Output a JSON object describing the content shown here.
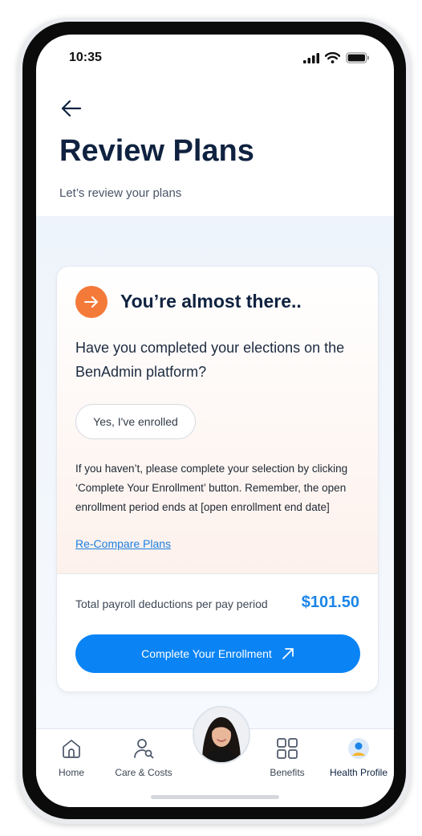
{
  "status_bar": {
    "time": "10:35"
  },
  "header": {
    "title": "Review Plans",
    "subtitle": "Let’s review your plans"
  },
  "card": {
    "heading": "You’re almost there..",
    "question": "Have you completed your elections on the BenAdmin platform?",
    "enrolled_button": "Yes, I've enrolled",
    "info_text": "If you haven’t, please complete your selection by clicking ‘Complete Your Enrollment’ button. Remember, the open enrollment period ends at [open enrollment end date]",
    "recompare_link": "Re-Compare Plans",
    "total_label": "Total payroll deductions per pay period",
    "total_amount": "$101.50",
    "cta_label": "Complete Your Enrollment"
  },
  "nav": {
    "items": [
      {
        "label": "Home",
        "icon": "home-icon"
      },
      {
        "label": "Care & Costs",
        "icon": "care-search-icon"
      },
      {
        "label": "Benefits",
        "icon": "grid-icon"
      },
      {
        "label": "Health Profile",
        "icon": "profile-icon"
      }
    ]
  },
  "colors": {
    "accent": "#0a84f5",
    "badge": "#f47a3a",
    "title": "#0f2240",
    "amount": "#1a85e8"
  }
}
